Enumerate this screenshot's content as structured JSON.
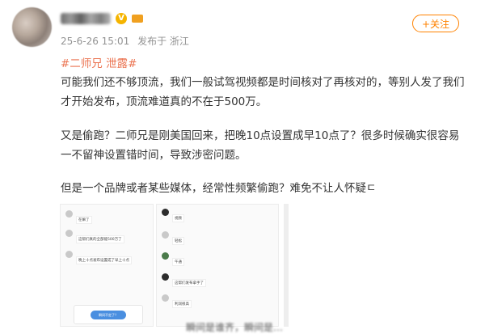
{
  "header": {
    "datetime": "25-6-26 15:01",
    "source": "发布于 浙江",
    "follow_label": "+关注"
  },
  "post": {
    "topic": "#二师兄 泄露#",
    "paragraphs": [
      "可能我们还不够顶流，我们一般试驾视频都是时间核对了再核对的，等别人发了我们才开始发布，顶流难道真的不在于500万。",
      "又是偷跑？二师兄是刚美国回来，把晚10点设置成早10点了？很多时候确实很容易一不留神设置错时间，导致涉密问题。",
      "但是一个品牌或者某些媒体，经常性频繁偷跑？难免不让人怀疑ㄷ"
    ]
  },
  "screenshot_left": {
    "messages": [
      "在嘛了",
      "这帮们真的全部能500万了",
      "晚上十点发布设置成了早上十点"
    ],
    "banner_label": "瞬间不定了？"
  },
  "screenshot_right": {
    "messages": [
      "视频",
      "轻松",
      "午通",
      "这帮们发布拿手了",
      "利润很高"
    ]
  },
  "footer": {
    "cut_text": "瞬间是谁齐，瞬间是…"
  }
}
